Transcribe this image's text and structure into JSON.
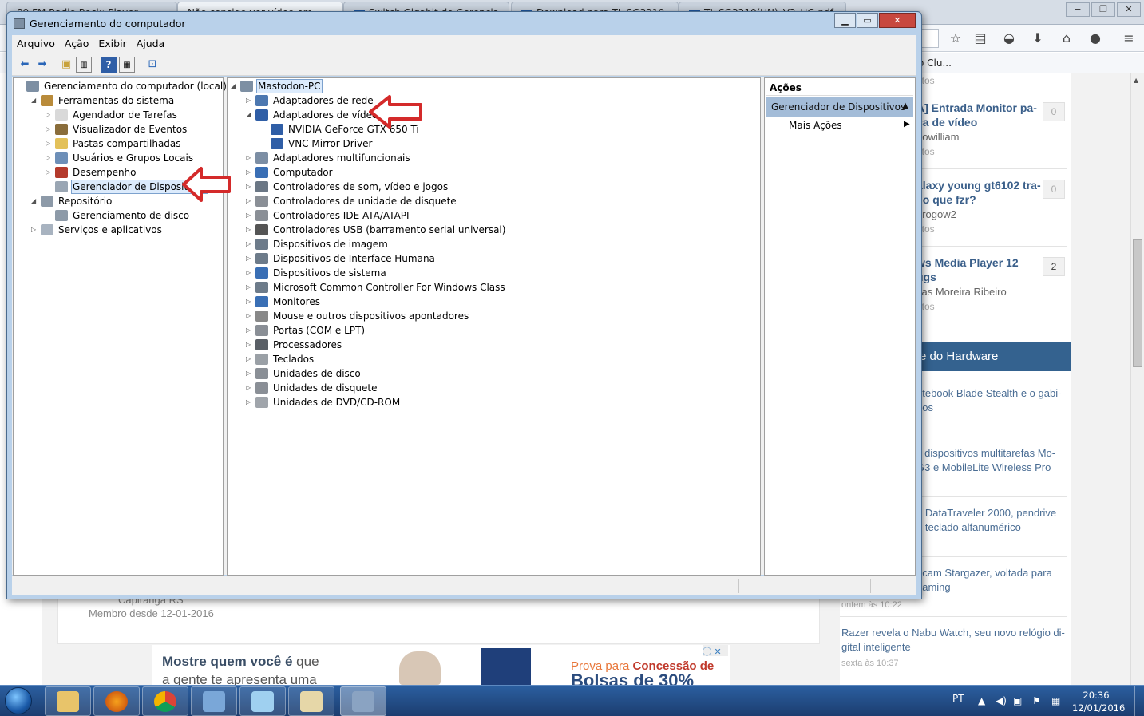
{
  "firefox": {
    "tabs": [
      {
        "label": "89 FM Radio Rock: Player",
        "badge": ""
      },
      {
        "label": "Não consigo ver vídeo em",
        "badge": ""
      },
      {
        "label": "Switch Gigabit de Gerencia",
        "badge": "TP"
      },
      {
        "label": "Download para TL-SG3210",
        "badge": "TP"
      },
      {
        "label": "TL-SG3210(UN)_V2_UG.pdf",
        "badge": "TP"
      }
    ],
    "bookmark_partial": "o Clu...",
    "sidebar_topics": [
      {
        "time_top": "utos",
        "title": "A] Entrada Monitor pa-\nca de vídeo",
        "author": "nowilliam",
        "time": "utos",
        "count": "0"
      },
      {
        "title": "alaxy young gt6102 tra-\n, o que fzr?",
        "author": "drogow2",
        "time": "utos",
        "count": "0"
      },
      {
        "title": "ws Media Player 12\nugs",
        "author": "cas Moreira Ribeiro",
        "time": "utos",
        "count": "2"
      }
    ],
    "news_header": "e do Hardware",
    "news": [
      {
        "title": "otebook Blade Stealth e o gabi-\ngos",
        "time": ""
      },
      {
        "title": "s dispositivos multitarefas Mo-\nG3 e MobileLite Wireless Pro",
        "time": ""
      },
      {
        "title": "o DataTraveler 2000, pendrive\ne teclado alfanumérico",
        "time": ""
      },
      {
        "title": "bcam Stargazer, voltada para\neaming",
        "time": "ontem às 10:22"
      },
      {
        "title": "Razer revela o Nabu Watch, seu novo relógio di-\ngital inteligente",
        "time": "sexta às 10:37"
      }
    ],
    "member_name": "Capiranga RS",
    "member_since": "Membro desde 12-01-2016",
    "ad": {
      "line1_bold": "Mostre quem você é",
      "line1_rest": " que",
      "line2": "a gente te apresenta uma",
      "right1": "Prova para ",
      "right1_bold": "Concessão de",
      "right2": "Bolsas de 30%"
    }
  },
  "mmc": {
    "title": "Gerenciamento do computador",
    "menu": [
      "Arquivo",
      "Ação",
      "Exibir",
      "Ajuda"
    ],
    "left_tree": [
      {
        "label": "Gerenciamento do computador (local)",
        "level": 0,
        "expander": "",
        "icon": "computer-management-icon"
      },
      {
        "label": "Ferramentas do sistema",
        "level": 1,
        "expander": "◢",
        "icon": "tools-icon"
      },
      {
        "label": "Agendador de Tarefas",
        "level": 2,
        "expander": "▷",
        "icon": "clock-icon"
      },
      {
        "label": "Visualizador de Eventos",
        "level": 2,
        "expander": "▷",
        "icon": "event-viewer-icon"
      },
      {
        "label": "Pastas compartilhadas",
        "level": 2,
        "expander": "▷",
        "icon": "shared-folder-icon"
      },
      {
        "label": "Usuários e Grupos Locais",
        "level": 2,
        "expander": "▷",
        "icon": "users-icon"
      },
      {
        "label": "Desempenho",
        "level": 2,
        "expander": "▷",
        "icon": "performance-icon"
      },
      {
        "label": "Gerenciador de Dispositivos",
        "level": 2,
        "expander": "",
        "icon": "device-manager-icon",
        "selected": true
      },
      {
        "label": "Repositório",
        "level": 1,
        "expander": "◢",
        "icon": "storage-icon"
      },
      {
        "label": "Gerenciamento de disco",
        "level": 2,
        "expander": "",
        "icon": "disk-management-icon"
      },
      {
        "label": "Serviços e aplicativos",
        "level": 1,
        "expander": "▷",
        "icon": "services-icon"
      }
    ],
    "device_root": "Mastodon-PC",
    "devices": [
      {
        "label": "Adaptadores de rede",
        "level": 1,
        "expander": "▷",
        "icon": "network-adapter-icon"
      },
      {
        "label": "Adaptadores de vídeo",
        "level": 1,
        "expander": "◢",
        "icon": "display-adapter-icon"
      },
      {
        "label": "NVIDIA GeForce GTX 650 Ti",
        "level": 2,
        "expander": "",
        "icon": "display-adapter-icon"
      },
      {
        "label": "VNC Mirror Driver",
        "level": 2,
        "expander": "",
        "icon": "display-adapter-icon"
      },
      {
        "label": "Adaptadores multifuncionais",
        "level": 1,
        "expander": "▷",
        "icon": "multifunction-icon"
      },
      {
        "label": "Computador",
        "level": 1,
        "expander": "▷",
        "icon": "computer-icon"
      },
      {
        "label": "Controladores de som, vídeo e jogos",
        "level": 1,
        "expander": "▷",
        "icon": "sound-icon"
      },
      {
        "label": "Controladores de unidade de disquete",
        "level": 1,
        "expander": "▷",
        "icon": "floppy-controller-icon"
      },
      {
        "label": "Controladores IDE ATA/ATAPI",
        "level": 1,
        "expander": "▷",
        "icon": "ide-icon"
      },
      {
        "label": "Controladores USB (barramento serial universal)",
        "level": 1,
        "expander": "▷",
        "icon": "usb-icon"
      },
      {
        "label": "Dispositivos de imagem",
        "level": 1,
        "expander": "▷",
        "icon": "imaging-icon"
      },
      {
        "label": "Dispositivos de Interface Humana",
        "level": 1,
        "expander": "▷",
        "icon": "hid-icon"
      },
      {
        "label": "Dispositivos de sistema",
        "level": 1,
        "expander": "▷",
        "icon": "system-device-icon"
      },
      {
        "label": "Microsoft Common Controller For Windows Class",
        "level": 1,
        "expander": "▷",
        "icon": "controller-icon"
      },
      {
        "label": "Monitores",
        "level": 1,
        "expander": "▷",
        "icon": "monitor-icon"
      },
      {
        "label": "Mouse e outros dispositivos apontadores",
        "level": 1,
        "expander": "▷",
        "icon": "mouse-icon"
      },
      {
        "label": "Portas (COM e LPT)",
        "level": 1,
        "expander": "▷",
        "icon": "port-icon"
      },
      {
        "label": "Processadores",
        "level": 1,
        "expander": "▷",
        "icon": "processor-icon"
      },
      {
        "label": "Teclados",
        "level": 1,
        "expander": "▷",
        "icon": "keyboard-icon"
      },
      {
        "label": "Unidades de disco",
        "level": 1,
        "expander": "▷",
        "icon": "disk-drive-icon"
      },
      {
        "label": "Unidades de disquete",
        "level": 1,
        "expander": "▷",
        "icon": "floppy-drive-icon"
      },
      {
        "label": "Unidades de DVD/CD-ROM",
        "level": 1,
        "expander": "▷",
        "icon": "dvd-icon"
      }
    ],
    "actions": {
      "title": "Ações",
      "section": "Gerenciador de Dispositivos",
      "more": "Mais Ações"
    }
  },
  "taskbar": {
    "apps": [
      "explorer-icon",
      "firefox-icon",
      "chrome-icon",
      "control-panel-icon",
      "network-icon",
      "paint-icon",
      "computer-management-icon"
    ],
    "lang": "PT",
    "time": "20:36",
    "date": "12/01/2016"
  },
  "colors": {
    "annotation_arrow": "#d42a2a",
    "selection": "#dcebfc",
    "actions_header": "#a3bcd8",
    "taskbar": "#1f4a82"
  }
}
